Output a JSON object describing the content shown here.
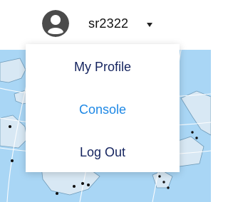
{
  "user": {
    "username": "sr2322",
    "avatar_icon": "user-avatar-icon",
    "dropdown_icon": "caret-down-icon"
  },
  "menu": {
    "items": [
      {
        "label": "My Profile",
        "color": "#15245f"
      },
      {
        "label": "Console",
        "color": "#1e88e5"
      },
      {
        "label": "Log Out",
        "color": "#15245f"
      }
    ]
  },
  "theme": {
    "map_water": "#a9d6f5",
    "map_land": "#d8e8f4",
    "map_grid": "#ffffff",
    "marker": "#111111"
  }
}
